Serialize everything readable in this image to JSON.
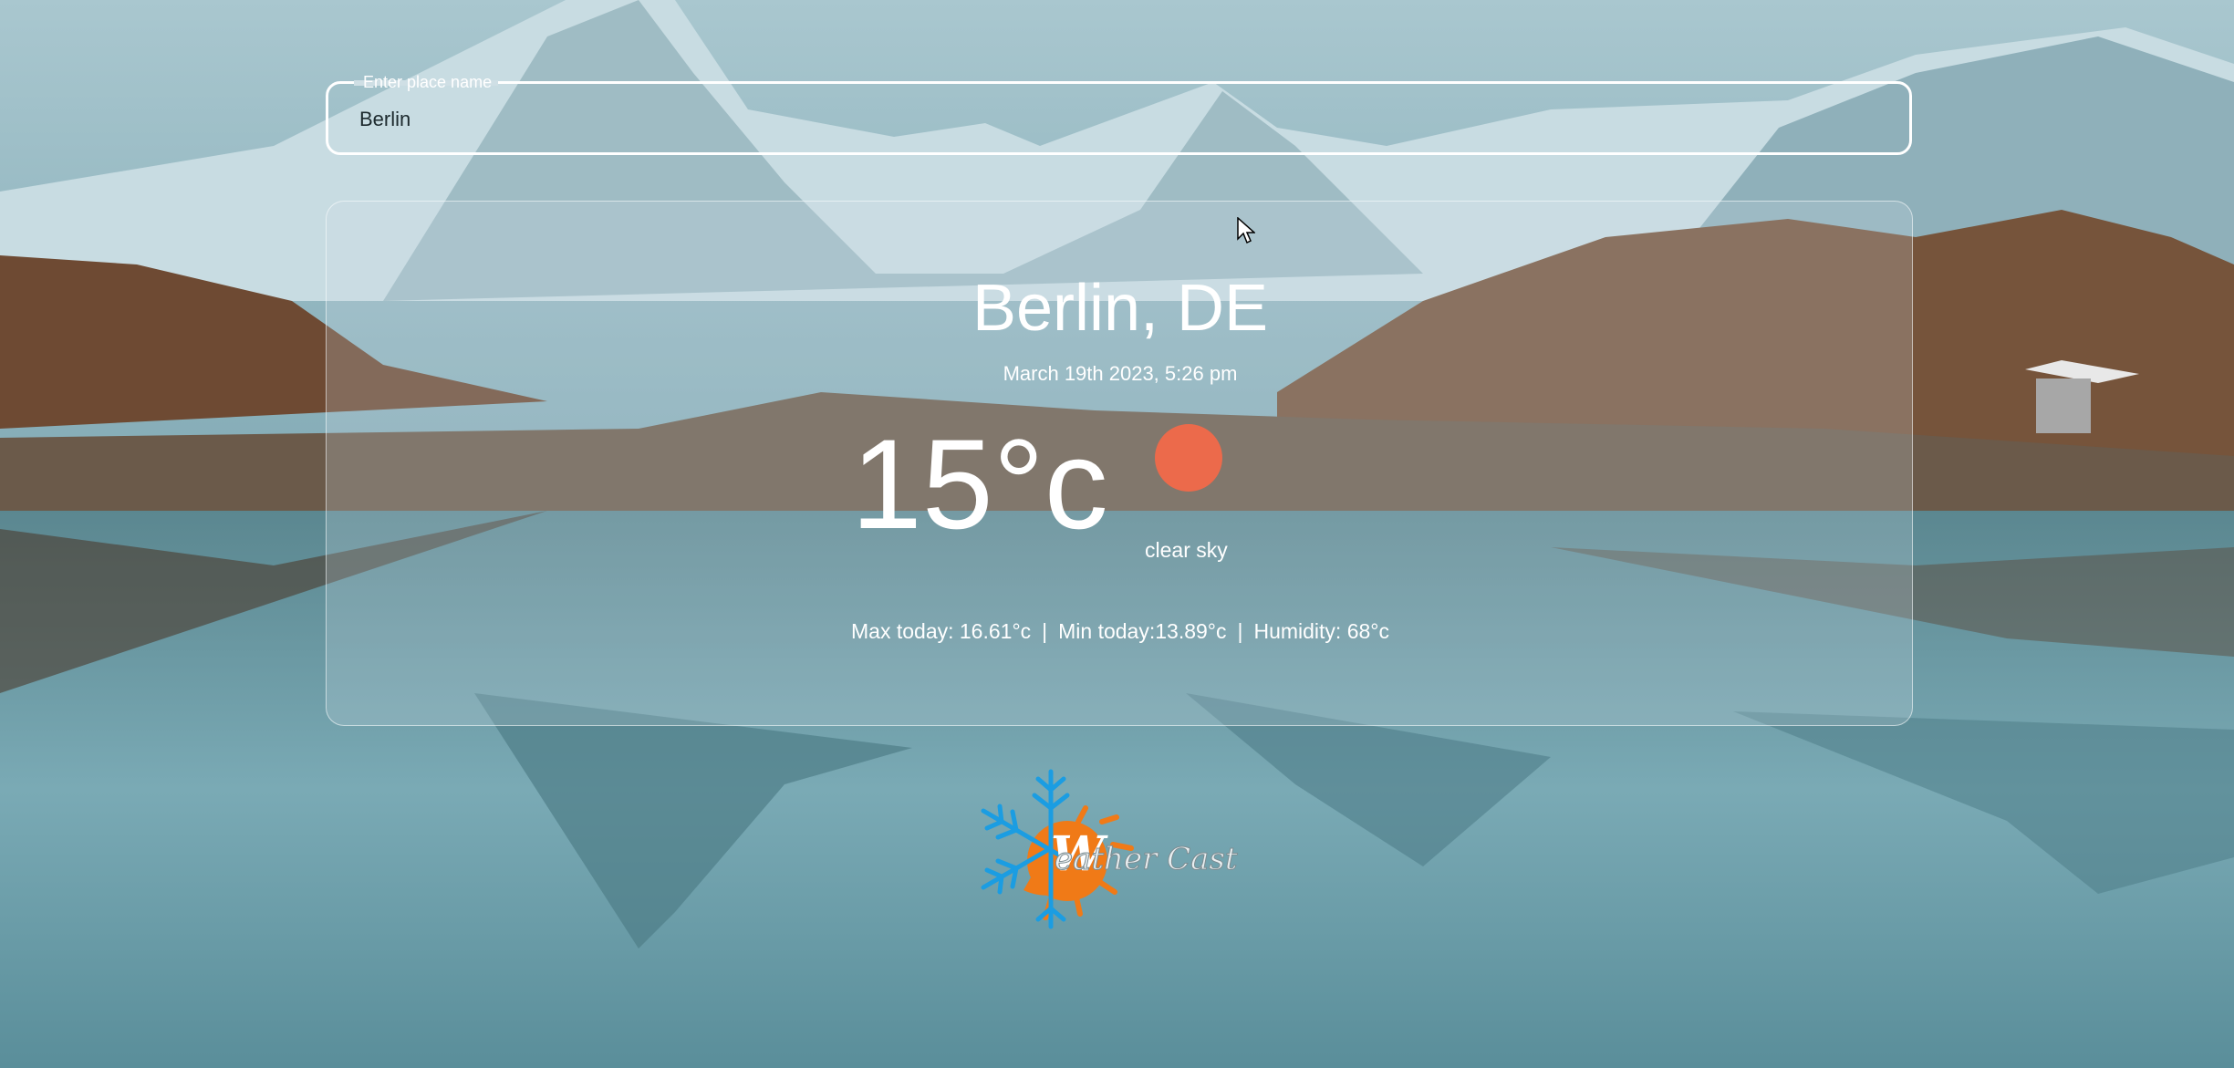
{
  "search": {
    "legend": "Enter place name",
    "value": "Berlin",
    "placeholder": ""
  },
  "weather": {
    "city": "Berlin, DE",
    "datetime": "March 19th 2023, 5:26 pm",
    "temperature": "15°c",
    "condition": "clear sky",
    "icon": "sun-icon",
    "stats": {
      "max": "Max today: 16.61°c",
      "min": "Min today:13.89°c",
      "humidity": "Humidity: 68°c",
      "separator": "|"
    }
  },
  "logo": {
    "letter": "W",
    "text": "eather Cast"
  },
  "colors": {
    "sun": "#ec6a4b",
    "logo_orange": "#f07a17",
    "logo_blue": "#1b9de2",
    "text": "#ffffff"
  }
}
